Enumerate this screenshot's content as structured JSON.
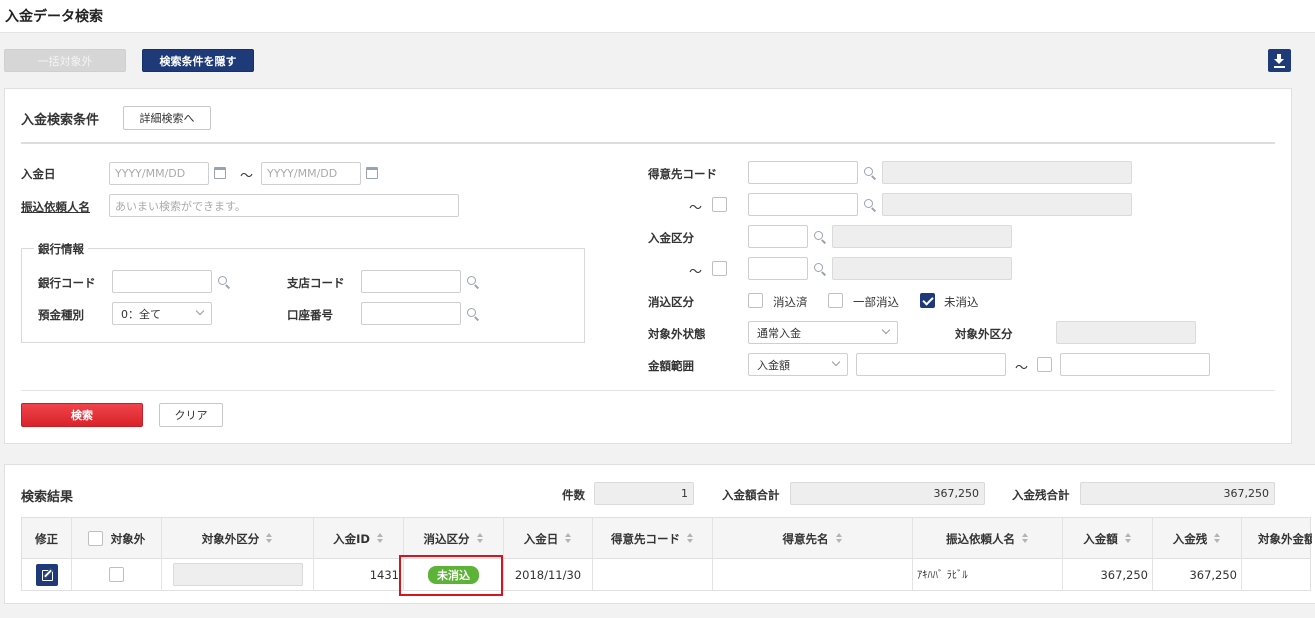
{
  "page": {
    "title": "入金データ検索"
  },
  "toolbar": {
    "bulk_exclude": "一括対象外",
    "hide_conditions": "検索条件を隠す",
    "download_icon": "download-icon"
  },
  "search": {
    "title": "入金検索条件",
    "detail_button": "詳細検索へ",
    "deposit_date_label": "入金日",
    "date_from_placeholder": "YYYY/MM/DD",
    "date_to_placeholder": "YYYY/MM/DD",
    "tilde": "～",
    "requester_label": "振込依頼人名",
    "requester_placeholder": "あいまい検索ができます。",
    "bank": {
      "legend": "銀行情報",
      "bank_code_label": "銀行コード",
      "branch_code_label": "支店コード",
      "deposit_type_label": "預金種別",
      "deposit_type_value": "0：全て",
      "account_no_label": "口座番号"
    },
    "customer_code_label": "得意先コード",
    "deposit_category_label": "入金区分",
    "clearing_label": "消込区分",
    "clearing_options": [
      "消込済",
      "一部消込",
      "未消込"
    ],
    "clearing_checked": [
      false,
      false,
      true
    ],
    "exclusion_status_label": "対象外状態",
    "exclusion_status_value": "通常入金",
    "exclusion_category_label": "対象外区分",
    "amount_range_label": "金額範囲",
    "amount_type_value": "入金額",
    "search_button": "検索",
    "clear_button": "クリア"
  },
  "results": {
    "title": "検索結果",
    "count_label": "件数",
    "count_value": "1",
    "deposit_total_label": "入金額合計",
    "deposit_total_value": "367,250",
    "remaining_total_label": "入金残合計",
    "remaining_total_value": "367,250",
    "columns": [
      "修正",
      "対象外",
      "対象外区分",
      "入金ID",
      "消込区分",
      "入金日",
      "得意先コード",
      "得意先名",
      "振込依頼人名",
      "入金額",
      "入金残",
      "対象外金額"
    ],
    "rows": [
      {
        "deposit_id": "1431",
        "status": "未消込",
        "date": "2018/11/30",
        "customer_code": "",
        "customer_name": "",
        "requester": "ｱｷﾊﾊﾞ ﾗﾋﾞﾙ",
        "amount": "367,250",
        "remaining": "367,250"
      }
    ]
  },
  "colors": {
    "navy": "#1e3a78",
    "red": "#e02a31",
    "badge_green": "#5cb338",
    "highlight": "#d9141c"
  }
}
